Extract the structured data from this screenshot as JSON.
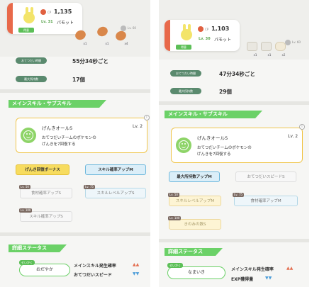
{
  "left": {
    "cp_label": "CP",
    "cp": "1,135",
    "level": "Lv. 31",
    "name": "パモット",
    "tag": "得意",
    "items": [
      {
        "qty": "x1",
        "icon": "berry-icon"
      },
      {
        "qty": "x1",
        "icon": "berry-icon"
      },
      {
        "qty": "x4",
        "icon": "berry-icon"
      }
    ],
    "lock_level": "Lv. 60",
    "help_time_label": "おてつだい時間",
    "help_time": "55分34秒ごと",
    "carry_label": "最大所持数",
    "carry": "17個",
    "section_skill": "メインスキル・サブスキル",
    "main_skill": {
      "name": "げんきオールS",
      "level": "Lv. 2",
      "desc1": "おてつだいチームのポケモンの",
      "desc2": "げんきを7回復する"
    },
    "subs": [
      {
        "label": "げんき回復ボーナス",
        "style": "gold"
      },
      {
        "label": "スキル確率アップM",
        "style": "blue"
      },
      {
        "label": "食材確率アップS",
        "style": "lock-gray",
        "unlock": "Lv. 50"
      },
      {
        "label": "スキルレベルアップS",
        "style": "lock-blue",
        "unlock": "Lv. 75"
      },
      {
        "label": "スキル確率アップS",
        "style": "lock-gray",
        "unlock": "Lv. 100"
      }
    ],
    "section_detail": "詳細ステータス",
    "nature_label": "せいかく",
    "nature": "おだやか",
    "eff1": "メインスキル発生確率",
    "eff1_arrows": "▲▲",
    "eff2": "おてつだいスピード",
    "eff2_arrows": "▼▼"
  },
  "right": {
    "cp_label": "CP",
    "cp": "1,103",
    "level": "Lv. 30",
    "name": "パモット",
    "tag": "得意",
    "items": [
      {
        "qty": "x1",
        "icon": "bottle-icon"
      },
      {
        "qty": "x1",
        "icon": "bottle-icon"
      },
      {
        "qty": "x2",
        "icon": "sack-icon"
      }
    ],
    "lock_level": "Lv. 60",
    "help_time_label": "おてつだい時間",
    "help_time": "47分34秒ごと",
    "carry_label": "最大所持数",
    "carry": "29個",
    "section_skill": "メインスキル・サブスキル",
    "main_skill": {
      "name": "げんきオールS",
      "level": "Lv. 2",
      "desc1": "おてつだいチームのポケモンの",
      "desc2": "げんきを7回復する"
    },
    "subs": [
      {
        "label": "最大所持数アップM",
        "style": "blue"
      },
      {
        "label": "おてつだいスピードS",
        "style": "lock-gray"
      },
      {
        "label": "スキルレベルアップM",
        "style": "lock-gold",
        "unlock": "Lv. 50"
      },
      {
        "label": "食材確率アップM",
        "style": "lock-blue",
        "unlock": "Lv. 75"
      },
      {
        "label": "きのみの数S",
        "style": "lock-gold",
        "unlock": "Lv. 100"
      }
    ],
    "section_detail": "詳細ステータス",
    "nature_label": "せいかく",
    "nature": "なまいき",
    "eff1": "メインスキル発生確率",
    "eff1_arrows": "▲▲",
    "eff2": "EXP獲得量",
    "eff2_arrows": "▼▼"
  },
  "colors": {
    "accent_green": "#6bd167",
    "cp_red": "#e06040",
    "skill_gold": "#f7dc5f",
    "skill_blue": "#dbeef8"
  }
}
